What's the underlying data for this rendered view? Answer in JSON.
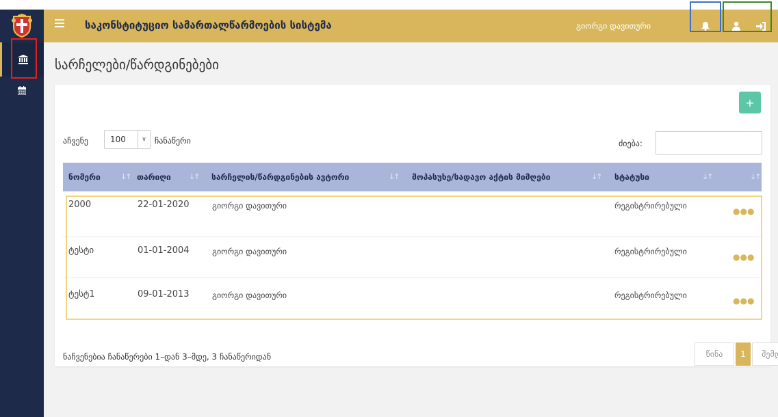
{
  "header": {
    "title": "საკონსტიტუციო სამართალწარმოების სისტემა",
    "user_name": "გიორგი დავითური"
  },
  "page": {
    "title": "სარჩელები/წარდგინებები"
  },
  "toolbar": {
    "add_label": "+",
    "show_label": "აჩვენე",
    "page_size": "100",
    "records_label": "ჩანაწერი",
    "search_label": "ძიება:"
  },
  "table": {
    "columns": [
      "ნომერი",
      "თარიღი",
      "სარჩელის/წარდგინების ავტორი",
      "მოპასუხე/სადავო აქტის მიმღები",
      "სტატუსი"
    ],
    "rows": [
      {
        "number": "2000",
        "date": "22-01-2020",
        "author": "გიორგი დავითური",
        "respondent": "",
        "status": "რეგისტრირებული"
      },
      {
        "number": "ტესტი",
        "date": "01-01-2004",
        "author": "გიორგი დავითური",
        "respondent": "",
        "status": "რეგისტრირებული"
      },
      {
        "number": "ტესტ1",
        "date": "09-01-2013",
        "author": "გიორგი დავითური",
        "respondent": "",
        "status": "რეგისტრირებული"
      }
    ]
  },
  "footer": {
    "info": "ნაჩვენებია ჩანაწერები 1–დან 3–მდე, 3 ჩანაწერიდან",
    "prev": "წინა",
    "current_page": "1",
    "next": "შემდეგი"
  },
  "colors": {
    "header_bg": "#d9b65b",
    "sidebar_bg": "#1e2a4a",
    "table_header_bg": "#aab5da",
    "add_button": "#5cc7a6"
  },
  "icons": [
    "menu-icon",
    "bell-icon",
    "user-icon",
    "logout-icon",
    "bank-icon",
    "calendar-icon",
    "sort-icon",
    "more-dots-icon"
  ]
}
